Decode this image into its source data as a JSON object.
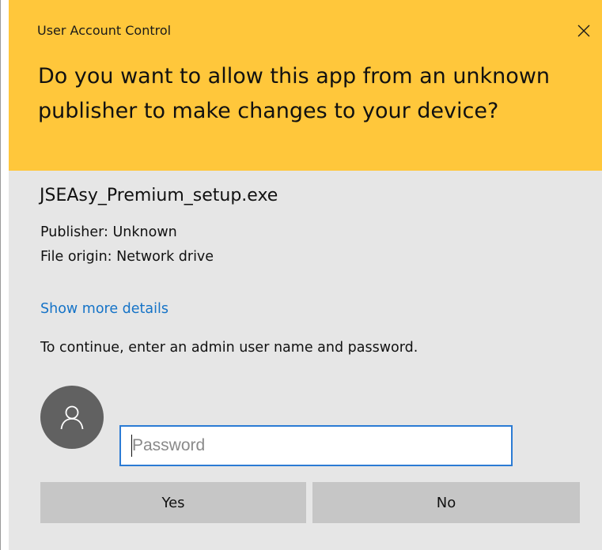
{
  "dialog": {
    "title": "User Account Control",
    "headline": "Do you want to allow this app from an unknown publisher to make changes to your device?",
    "accent_color": "#ffc73b",
    "close_icon": "close-icon"
  },
  "app": {
    "name": "JSEAsy_Premium_setup.exe",
    "publisher": "Publisher: Unknown",
    "origin": "File origin: Network drive"
  },
  "details_link": "Show more details",
  "instructions": "To continue, enter an admin user name and password.",
  "credentials": {
    "avatar_icon": "user-icon",
    "password_placeholder": "Password",
    "password_value": ""
  },
  "buttons": {
    "yes_label": "Yes",
    "no_label": "No"
  }
}
